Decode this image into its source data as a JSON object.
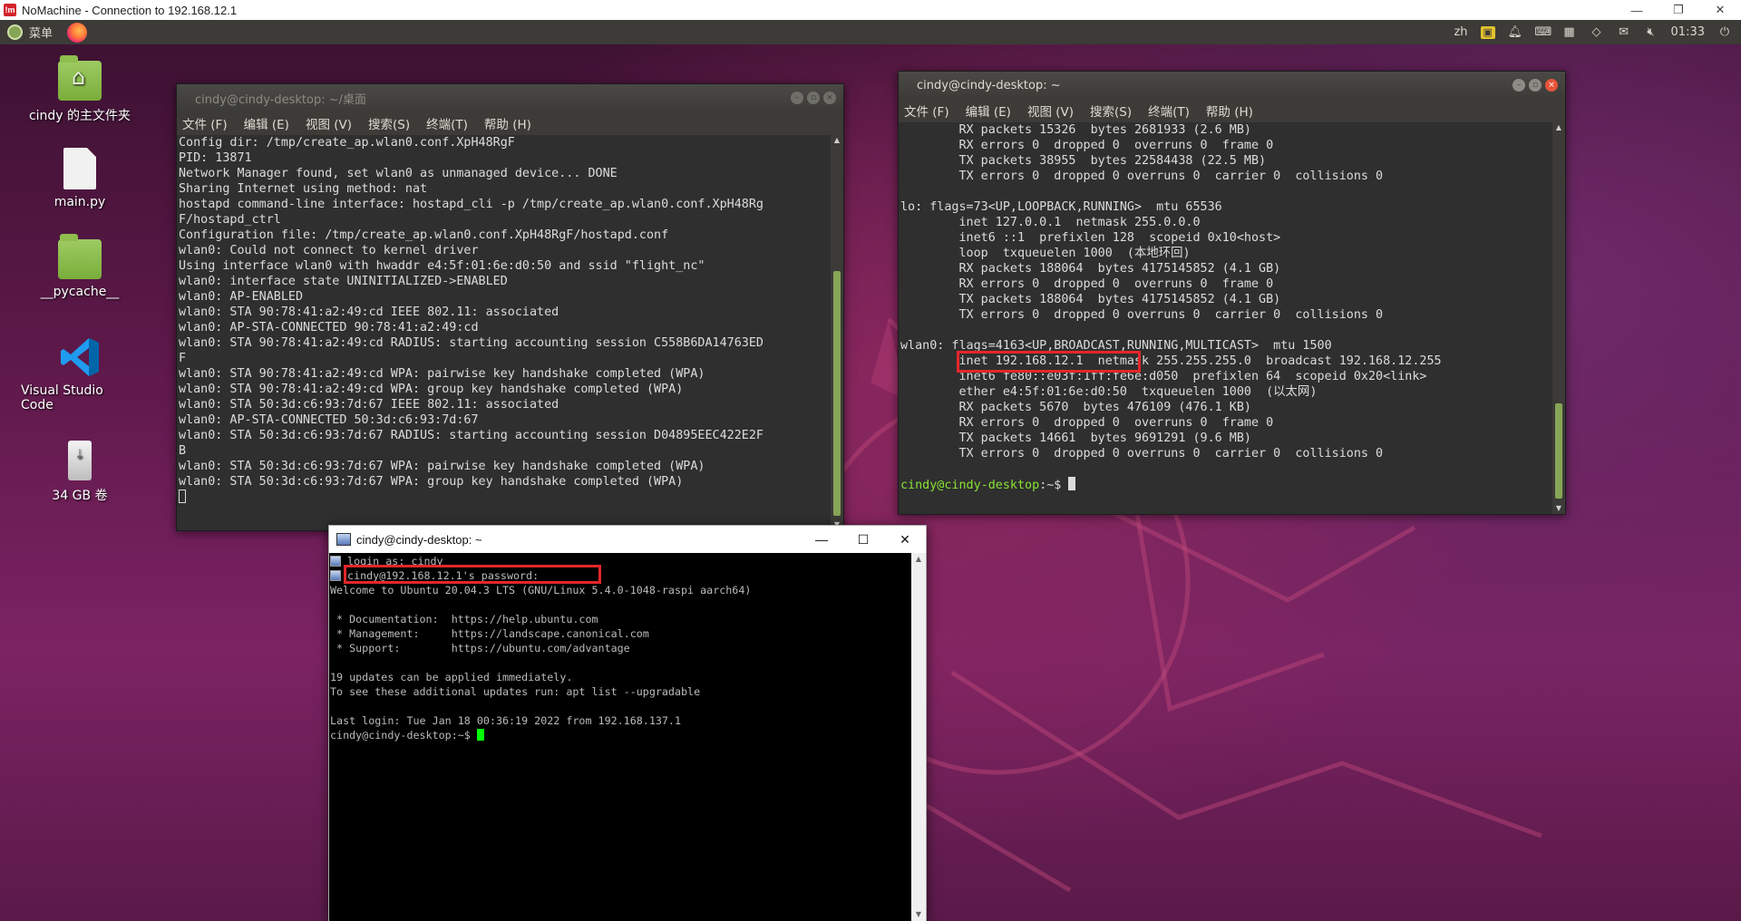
{
  "nomachine": {
    "logo_text": "!m",
    "title": "NoMachine - Connection to 192.168.12.1",
    "controls": [
      "—",
      "❐",
      "✕"
    ]
  },
  "panel": {
    "menu_label": "菜单",
    "tray": {
      "lang": "zh",
      "clock": "01:33"
    }
  },
  "desktop_icons": [
    {
      "label": "cindy 的主文件夹",
      "icon": "home-folder-icon"
    },
    {
      "label": "main.py",
      "icon": "python-file-icon"
    },
    {
      "label": "__pycache__",
      "icon": "folder-icon"
    },
    {
      "label": "Visual Studio Code",
      "icon": "vscode-icon"
    },
    {
      "label": "34 GB 卷",
      "icon": "usb-drive-icon"
    }
  ],
  "terminal_left": {
    "title": "cindy@cindy-desktop: ~/桌面",
    "menu": [
      "文件 (F)",
      "编辑 (E)",
      "视图 (V)",
      "搜索(S)",
      "终端(T)",
      "帮助 (H)"
    ],
    "lines": [
      "Config dir: /tmp/create_ap.wlan0.conf.XpH48RgF",
      "PID: 13871",
      "Network Manager found, set wlan0 as unmanaged device... DONE",
      "Sharing Internet using method: nat",
      "hostapd command-line interface: hostapd_cli -p /tmp/create_ap.wlan0.conf.XpH48Rg",
      "F/hostapd_ctrl",
      "Configuration file: /tmp/create_ap.wlan0.conf.XpH48RgF/hostapd.conf",
      "wlan0: Could not connect to kernel driver",
      "Using interface wlan0 with hwaddr e4:5f:01:6e:d0:50 and ssid \"flight_nc\"",
      "wlan0: interface state UNINITIALIZED->ENABLED",
      "wlan0: AP-ENABLED",
      "wlan0: STA 90:78:41:a2:49:cd IEEE 802.11: associated",
      "wlan0: AP-STA-CONNECTED 90:78:41:a2:49:cd",
      "wlan0: STA 90:78:41:a2:49:cd RADIUS: starting accounting session C558B6DA14763ED",
      "F",
      "wlan0: STA 90:78:41:a2:49:cd WPA: pairwise key handshake completed (WPA)",
      "wlan0: STA 90:78:41:a2:49:cd WPA: group key handshake completed (WPA)",
      "wlan0: STA 50:3d:c6:93:7d:67 IEEE 802.11: associated",
      "wlan0: AP-STA-CONNECTED 50:3d:c6:93:7d:67",
      "wlan0: STA 50:3d:c6:93:7d:67 RADIUS: starting accounting session D04895EEC422E2F",
      "B",
      "wlan0: STA 50:3d:c6:93:7d:67 WPA: pairwise key handshake completed (WPA)",
      "wlan0: STA 50:3d:c6:93:7d:67 WPA: group key handshake completed (WPA)"
    ]
  },
  "terminal_right": {
    "title": "cindy@cindy-desktop: ~",
    "menu": [
      "文件 (F)",
      "编辑 (E)",
      "视图 (V)",
      "搜索(S)",
      "终端(T)",
      "帮助 (H)"
    ],
    "lines": [
      "        RX packets 15326  bytes 2681933 (2.6 MB)",
      "        RX errors 0  dropped 0  overruns 0  frame 0",
      "        TX packets 38955  bytes 22584438 (22.5 MB)",
      "        TX errors 0  dropped 0 overruns 0  carrier 0  collisions 0",
      "",
      "lo: flags=73<UP,LOOPBACK,RUNNING>  mtu 65536",
      "        inet 127.0.0.1  netmask 255.0.0.0",
      "        inet6 ::1  prefixlen 128  scopeid 0x10<host>",
      "        loop  txqueuelen 1000  (本地环回)",
      "        RX packets 188064  bytes 4175145852 (4.1 GB)",
      "        RX errors 0  dropped 0  overruns 0  frame 0",
      "        TX packets 188064  bytes 4175145852 (4.1 GB)",
      "        TX errors 0  dropped 0 overruns 0  carrier 0  collisions 0",
      "",
      "wlan0: flags=4163<UP,BROADCAST,RUNNING,MULTICAST>  mtu 1500",
      "        inet 192.168.12.1  netmask 255.255.255.0  broadcast 192.168.12.255",
      "        inet6 fe80::e03f:1ff:fe6e:d050  prefixlen 64  scopeid 0x20<link>",
      "        ether e4:5f:01:6e:d0:50  txqueuelen 1000  (以太网)",
      "        RX packets 5670  bytes 476109 (476.1 KB)",
      "        RX errors 0  dropped 0  overruns 0  frame 0",
      "        TX packets 14661  bytes 9691291 (9.6 MB)",
      "        TX errors 0  dropped 0 overruns 0  carrier 0  collisions 0",
      ""
    ],
    "prompt_user": "cindy@cindy-desktop",
    "prompt_rest": ":~$ "
  },
  "putty": {
    "title": "cindy@cindy-desktop: ~",
    "controls": [
      "—",
      "☐",
      "✕"
    ],
    "lines": [
      " login as: cindy",
      " cindy@192.168.12.1's password:",
      "Welcome to Ubuntu 20.04.3 LTS (GNU/Linux 5.4.0-1048-raspi aarch64)",
      "",
      " * Documentation:  https://help.ubuntu.com",
      " * Management:     https://landscape.canonical.com",
      " * Support:        https://ubuntu.com/advantage",
      "",
      "19 updates can be applied immediately.",
      "To see these additional updates run: apt list --upgradable",
      "",
      "Last login: Tue Jan 18 00:36:19 2022 from 192.168.137.1"
    ],
    "prompt": "cindy@cindy-desktop:~$ "
  },
  "colors": {
    "highlight_box": "#e4262a",
    "prompt_green": "#8ae234",
    "putty_cursor": "#00ff00"
  }
}
